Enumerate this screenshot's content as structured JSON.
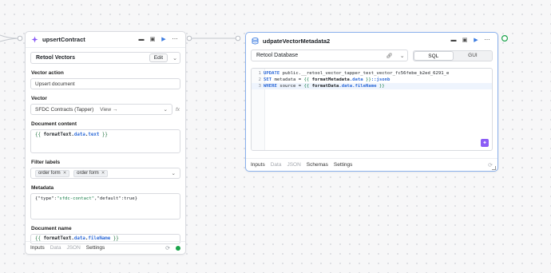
{
  "colors": {
    "accent": "#3b7be0",
    "success": "#1aa34a",
    "selected_border": "#8ab0ec",
    "retool_purple": "#8b5cf6"
  },
  "upsert_block": {
    "title": "upsertContract",
    "icon": "vector-icon",
    "resource": "Retool Vectors",
    "edit_label": "Edit",
    "vector_action_label": "Vector action",
    "vector_action_value": "Upsert document",
    "vector_label": "Vector",
    "vector_value": "SFDC Contracts (Tapper)",
    "view_label": "View →",
    "fx_label": "fx",
    "document_content_label": "Document content",
    "document_content": {
      "open": "{{",
      "obj": "formatText",
      "dot1": ".",
      "p1": "data",
      "dot2": ".",
      "p2": "text",
      "close": "}}"
    },
    "filter_labels_label": "Filter labels",
    "filter_tags": [
      "order form",
      "order form"
    ],
    "metadata_label": "Metadata",
    "metadata": {
      "k1": "{\"type\":",
      "v1": "\"sfdc-contact\"",
      "k2": ",\"default\":true}"
    },
    "document_name_label": "Document name",
    "document_name": {
      "open": "{{",
      "obj": "formatText",
      "dot1": ".",
      "p1": "data",
      "dot2": ".",
      "p2": "fileName",
      "close": "}}"
    },
    "footer_tabs": [
      "Inputs",
      "Data",
      "JSON",
      "Settings"
    ]
  },
  "sql_block": {
    "title": "udpateVectorMetadata2",
    "icon": "database-icon",
    "resource": "Retool Database",
    "mode_tabs": [
      "SQL",
      "GUI"
    ],
    "active_mode": "SQL",
    "lines": [
      {
        "n": "1",
        "kw": "UPDATE",
        "rest": " public.__retool_vector_tapper_test_vector_fc56febe_b2ed_6291_e"
      },
      {
        "n": "2",
        "kw": "SET",
        "rest": " metadata = ",
        "t_open": "{{ ",
        "t_obj": "formatMetadata",
        "t_prop": ".data",
        "t_close": " }}",
        "suffix": "::jsonb"
      },
      {
        "n": "3",
        "kw": "WHERE",
        "rest": " source = ",
        "t_open": "{{ ",
        "t_obj": "formatData",
        "t_prop": ".data.fileName",
        "t_close": " }}"
      }
    ],
    "footer_tabs": [
      "Inputs",
      "Data",
      "JSON",
      "Schemas",
      "Settings"
    ]
  }
}
